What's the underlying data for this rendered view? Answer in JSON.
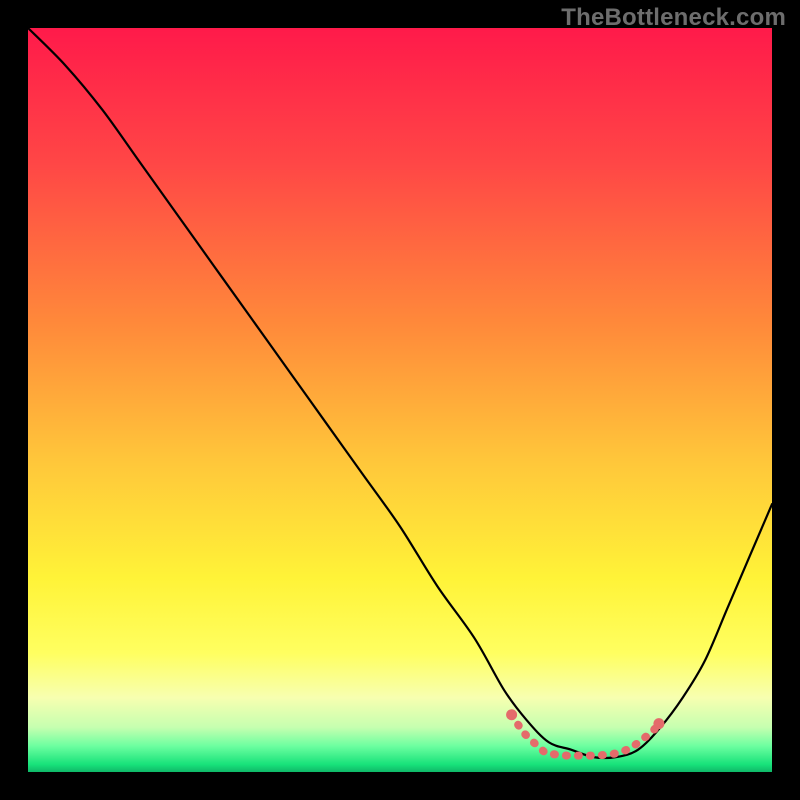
{
  "watermark": "TheBottleneck.com",
  "chart_data": {
    "type": "line",
    "title": "",
    "xlabel": "",
    "ylabel": "",
    "xlim": [
      0,
      100
    ],
    "ylim": [
      0,
      100
    ],
    "grid": false,
    "legend": false,
    "series": [
      {
        "name": "curve",
        "color": "#000000",
        "x": [
          0,
          5,
          10,
          15,
          20,
          25,
          30,
          35,
          40,
          45,
          50,
          55,
          60,
          64,
          67,
          70,
          73,
          76,
          79,
          82,
          85,
          88,
          91,
          94,
          97,
          100
        ],
        "y": [
          100,
          95,
          89,
          82,
          75,
          68,
          61,
          54,
          47,
          40,
          33,
          25,
          18,
          11,
          7,
          4,
          3,
          2,
          2,
          3,
          6,
          10,
          15,
          22,
          29,
          36
        ]
      },
      {
        "name": "flat-highlight",
        "type": "scatter",
        "color": "#e46b6b",
        "x": [
          65.0,
          66.5,
          67.5,
          69.5,
          70.5,
          71.5,
          72.5,
          73.5,
          74.5,
          75.5,
          76.5,
          77.5,
          78.5,
          79.5,
          80.0,
          81.0,
          82.5,
          84.0,
          84.8
        ],
        "y": [
          7.7,
          5.4,
          4.4,
          2.6,
          2.4,
          2.3,
          2.2,
          2.2,
          2.2,
          2.2,
          2.2,
          2.3,
          2.4,
          2.6,
          2.8,
          3.2,
          4.3,
          5.5,
          6.5
        ]
      }
    ],
    "gradient": {
      "stops": [
        {
          "pos": 0.0,
          "color": "#ff1a4a"
        },
        {
          "pos": 0.18,
          "color": "#ff4646"
        },
        {
          "pos": 0.4,
          "color": "#ff8a3a"
        },
        {
          "pos": 0.58,
          "color": "#ffc63a"
        },
        {
          "pos": 0.74,
          "color": "#fff338"
        },
        {
          "pos": 0.84,
          "color": "#ffff60"
        },
        {
          "pos": 0.9,
          "color": "#f7ffb0"
        },
        {
          "pos": 0.94,
          "color": "#c6ffb0"
        },
        {
          "pos": 0.965,
          "color": "#6dffa0"
        },
        {
          "pos": 0.99,
          "color": "#17e27a"
        },
        {
          "pos": 1.0,
          "color": "#0fb868"
        }
      ]
    }
  }
}
